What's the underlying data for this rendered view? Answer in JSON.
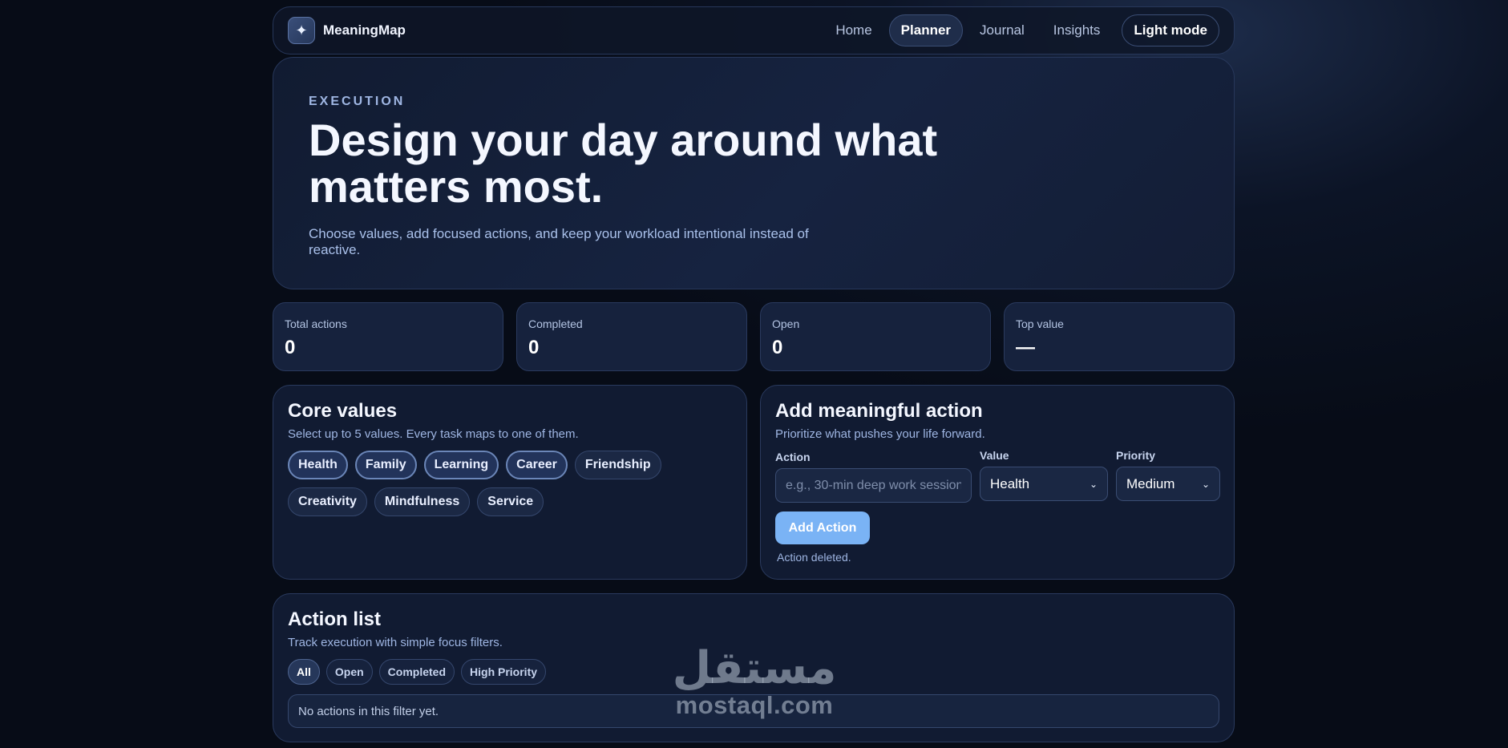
{
  "nav": {
    "brand": "MeaningMap",
    "logo_icon": "sparkle-icon",
    "links": [
      "Home",
      "Planner",
      "Journal",
      "Insights"
    ],
    "active": "Planner",
    "mode_toggle": "Light mode"
  },
  "hero": {
    "eyebrow": "EXECUTION",
    "title": "Design your day around what matters most.",
    "subtitle": "Choose values, add focused actions, and keep your workload intentional instead of reactive."
  },
  "stats": [
    {
      "label": "Total actions",
      "value": "0"
    },
    {
      "label": "Completed",
      "value": "0"
    },
    {
      "label": "Open",
      "value": "0"
    },
    {
      "label": "Top value",
      "value": "—"
    }
  ],
  "values_panel": {
    "title": "Core values",
    "subtitle": "Select up to 5 values. Every task maps to one of them.",
    "chips": [
      "Health",
      "Family",
      "Learning",
      "Career",
      "Friendship",
      "Creativity",
      "Mindfulness",
      "Service"
    ],
    "selected": [
      "Health",
      "Family",
      "Learning",
      "Career"
    ]
  },
  "action_form": {
    "title": "Add meaningful action",
    "subtitle": "Prioritize what pushes your life forward.",
    "action_label": "Action",
    "action_placeholder": "e.g., 30-min deep work session",
    "value_label": "Value",
    "value_selected": "Health",
    "priority_label": "Priority",
    "priority_selected": "Medium",
    "button": "Add Action",
    "status": "Action deleted."
  },
  "action_list": {
    "title": "Action list",
    "subtitle": "Track execution with simple focus filters.",
    "filters": [
      "All",
      "Open",
      "Completed",
      "High Priority"
    ],
    "active_filter": "All",
    "empty_text": "No actions in this filter yet."
  },
  "watermark": {
    "arabic": "مستقل",
    "latin": "mostaql.com"
  }
}
